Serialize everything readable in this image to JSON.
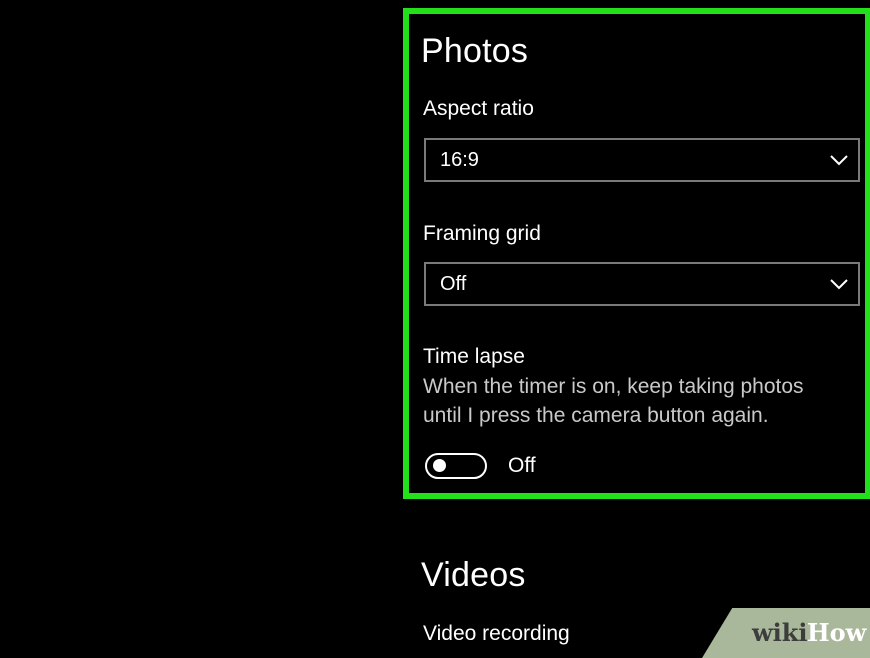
{
  "photos": {
    "title": "Photos",
    "aspect_ratio": {
      "label": "Aspect ratio",
      "value": "16:9"
    },
    "framing_grid": {
      "label": "Framing grid",
      "value": "Off"
    },
    "time_lapse": {
      "label": "Time lapse",
      "description_line1": "When the timer is on, keep taking photos",
      "description_line2": "until I press the camera button again.",
      "toggle_state": "Off"
    }
  },
  "videos": {
    "title": "Videos",
    "video_recording_label": "Video recording"
  },
  "watermark": {
    "part1": "wiki",
    "part2": "How"
  },
  "colors": {
    "highlight": "#22e01a",
    "background": "#000000",
    "dropdown_border": "#7a7a7a"
  },
  "icons": [
    "chevron-down-icon",
    "toggle-switch"
  ]
}
